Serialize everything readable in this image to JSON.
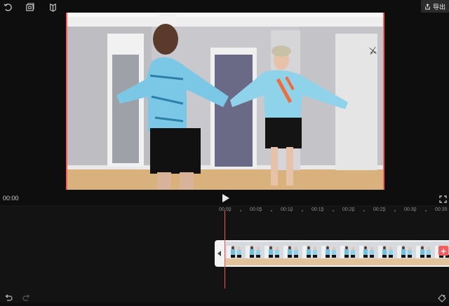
{
  "toolbar": {
    "icons": [
      "rotate-icon",
      "crop-frame-icon",
      "mirror-icon"
    ],
    "export_label": "导出"
  },
  "player": {
    "current_time": "00:00"
  },
  "timeline": {
    "ruler_labels": [
      "00:00",
      "00:05",
      "00:10",
      "00:15",
      "00:20",
      "00:25",
      "00:30",
      "00:35"
    ],
    "clip": {
      "badge": "",
      "duration": ""
    },
    "add_label": "+"
  },
  "colors": {
    "accent": "#ff4b4b",
    "background": "#0e0e0e"
  }
}
